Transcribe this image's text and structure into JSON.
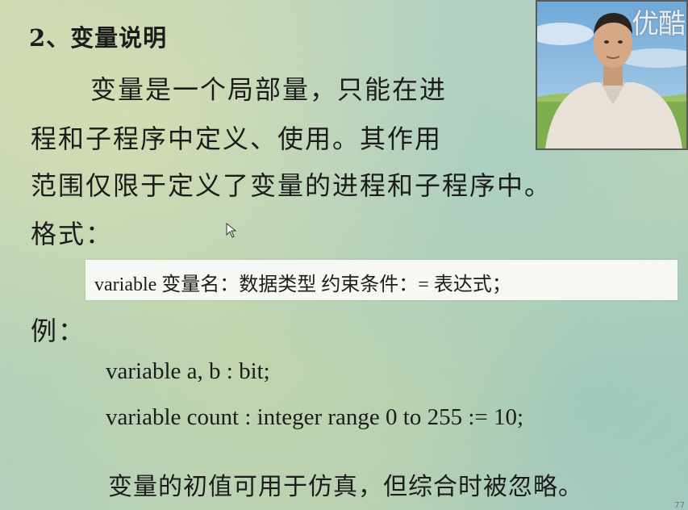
{
  "slide": {
    "section_title": "2、变量说明",
    "paragraph_lines": [
      "变量是一个局部量，只能在进",
      "程和子程序中定义、使用。其作用",
      "范围仅限于定义了变量的进程和子程序中。"
    ],
    "format_label": "格式：",
    "syntax": "variable  变量名：数据类型   约束条件：= 表达式；",
    "example_label": "例：",
    "code_lines": [
      "variable  a, b : bit;",
      "variable  count : integer range 0 to 255 := 10;"
    ],
    "note": "变量的初值可用于仿真，但综合时被忽略。",
    "page_number": "77"
  },
  "video": {
    "watermark": "优酷"
  },
  "colors": {
    "background": "#c2d6ba",
    "syntax_box": "#f6f8f4",
    "text": "#1c1c1c"
  }
}
